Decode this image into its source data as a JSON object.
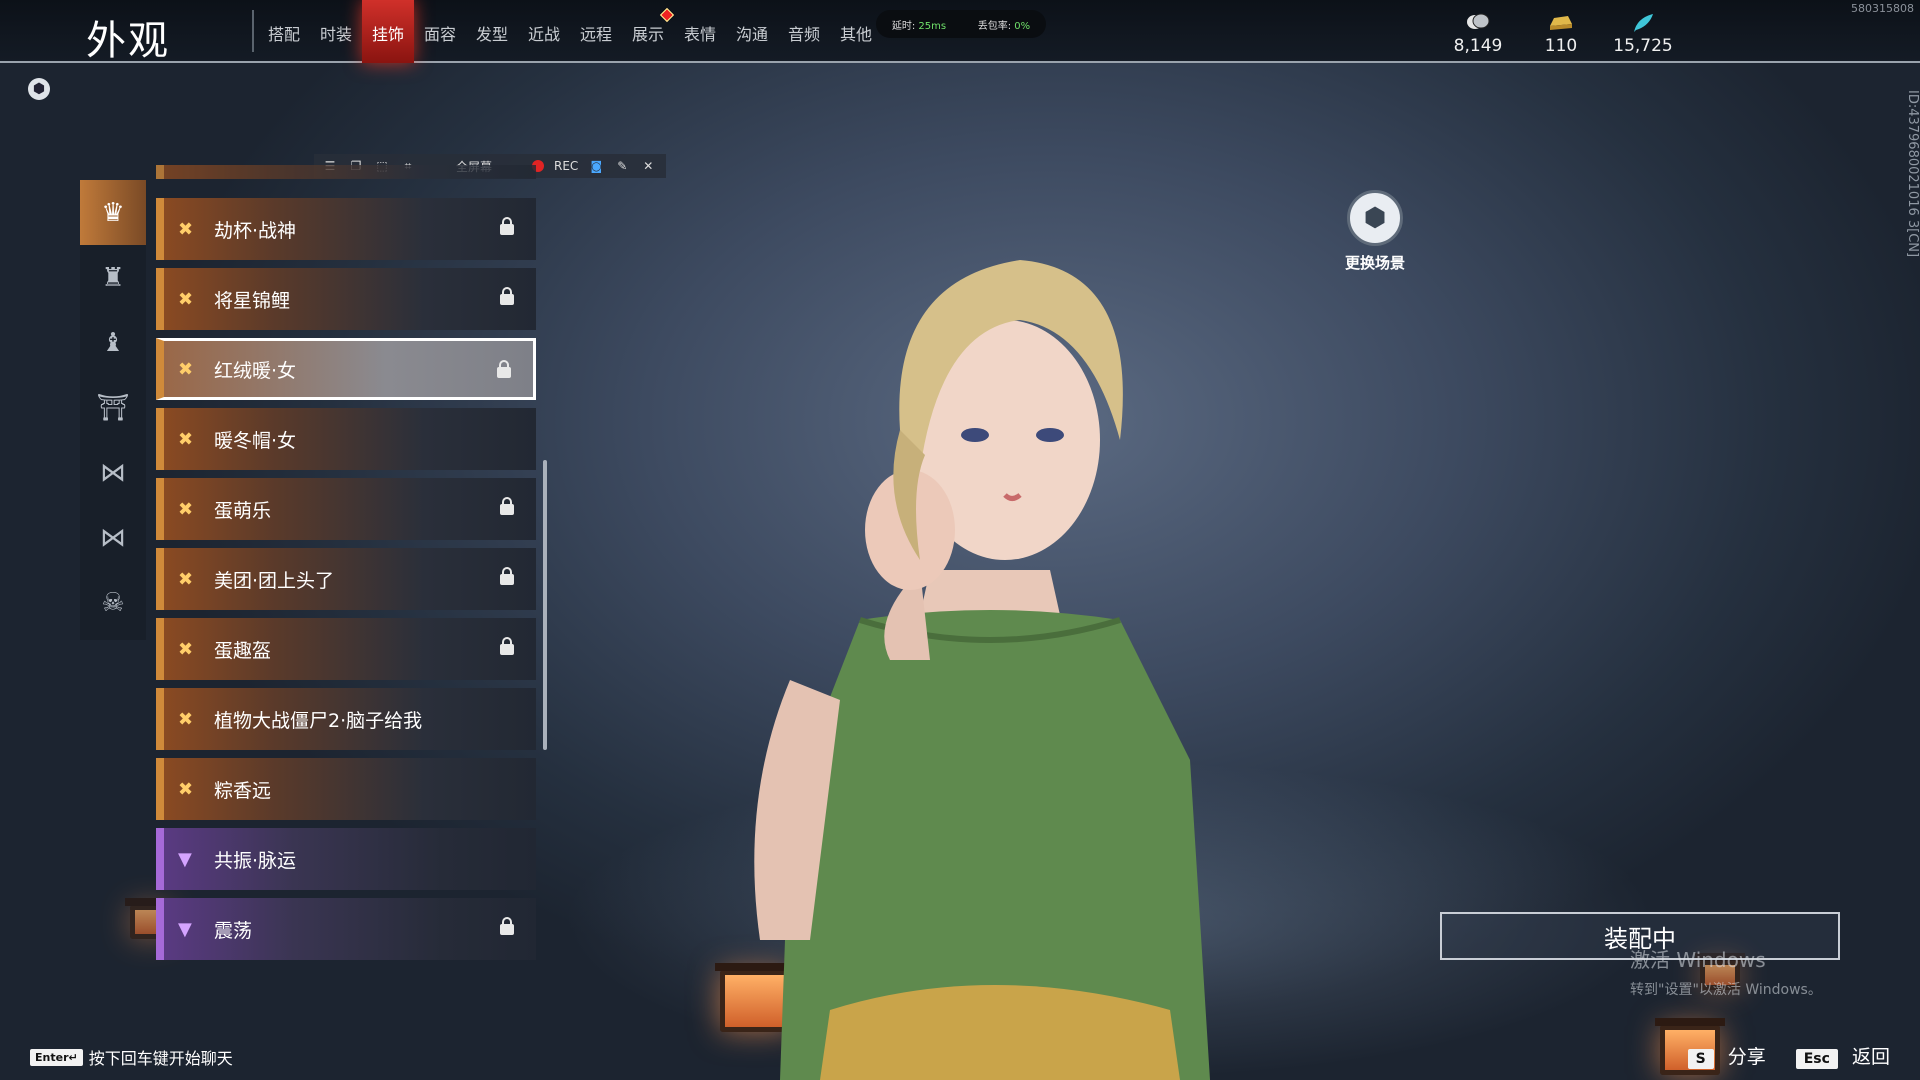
{
  "header": {
    "title": "外观",
    "tabs": [
      {
        "label": "搭配",
        "active": false
      },
      {
        "label": "时装",
        "active": false
      },
      {
        "label": "挂饰",
        "active": true
      },
      {
        "label": "面容",
        "active": false
      },
      {
        "label": "发型",
        "active": false
      },
      {
        "label": "近战",
        "active": false
      },
      {
        "label": "远程",
        "active": false
      },
      {
        "label": "展示",
        "active": false,
        "has_badge": true
      },
      {
        "label": "表情",
        "active": false
      },
      {
        "label": "沟通",
        "active": false
      },
      {
        "label": "音频",
        "active": false
      },
      {
        "label": "其他",
        "active": false
      }
    ],
    "network": {
      "latency_label": "延时:",
      "latency_value": "25ms",
      "loss_label": "丢包率:",
      "loss_value": "0%"
    },
    "currencies": [
      {
        "icon": "coin-stack-icon",
        "value": "8,149"
      },
      {
        "icon": "gold-ingot-icon",
        "value": "110"
      },
      {
        "icon": "feather-icon",
        "value": "15,725"
      }
    ],
    "corner_id": "580315808"
  },
  "side_id": "ID:4379680021016 3[CN]",
  "rec_toolbar": {
    "fullscreen_label": "全屏幕",
    "rec_label": "REC"
  },
  "categories": [
    {
      "icon": "helmet-icon",
      "active": true
    },
    {
      "icon": "mask-icon",
      "active": false
    },
    {
      "icon": "back-ornament-icon",
      "active": false
    },
    {
      "icon": "shoulder-icon",
      "active": false
    },
    {
      "icon": "waist-ornament-icon",
      "active": false
    },
    {
      "icon": "bow-icon",
      "active": false
    },
    {
      "icon": "demon-face-icon",
      "active": false
    }
  ],
  "items": [
    {
      "name": "劫杯·战神",
      "locked": true,
      "quality": "legendary"
    },
    {
      "name": "将星锦鲤",
      "locked": true,
      "quality": "legendary"
    },
    {
      "name": "红绒暖·女",
      "locked": true,
      "quality": "legendary",
      "selected": true
    },
    {
      "name": "暖冬帽·女",
      "locked": false,
      "quality": "legendary"
    },
    {
      "name": "蛋萌乐",
      "locked": true,
      "quality": "legendary"
    },
    {
      "name": "美团·团上头了",
      "locked": true,
      "quality": "legendary"
    },
    {
      "name": "蛋趣盔",
      "locked": true,
      "quality": "legendary"
    },
    {
      "name": "植物大战僵尸2·脑子给我",
      "locked": false,
      "quality": "legendary"
    },
    {
      "name": "粽香远",
      "locked": false,
      "quality": "legendary"
    },
    {
      "name": "共振·脉运",
      "locked": false,
      "quality": "epic"
    },
    {
      "name": "震荡",
      "locked": true,
      "quality": "epic"
    }
  ],
  "scene": {
    "label": "更换场景"
  },
  "equip_button": {
    "label": "装配中"
  },
  "watermark": {
    "line1": "激活 Windows",
    "line2": "转到\"设置\"以激活 Windows。"
  },
  "chat_hint": {
    "key": "Enter↵",
    "text": "按下回车键开始聊天"
  },
  "actions": [
    {
      "key": "S",
      "label": "分享"
    },
    {
      "key": "Esc",
      "label": "返回"
    }
  ]
}
